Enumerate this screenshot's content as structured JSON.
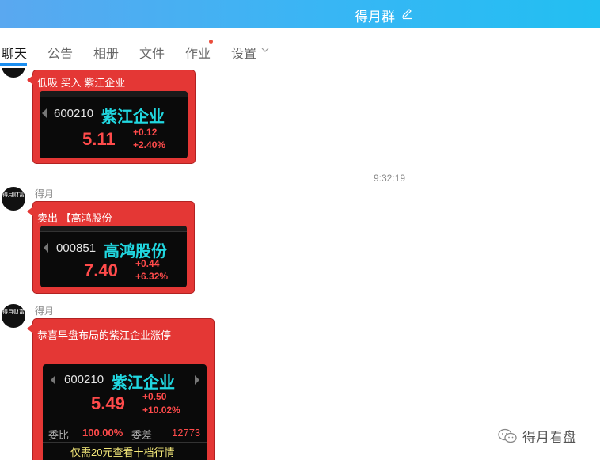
{
  "header": {
    "title": "得月群",
    "edit_icon": "edit-icon",
    "colors": {
      "start": "#5aa8f0",
      "end": "#22bff2"
    }
  },
  "tabs": [
    {
      "label": "聊天",
      "active": true
    },
    {
      "label": "公告"
    },
    {
      "label": "相册"
    },
    {
      "label": "文件"
    },
    {
      "label": "作业",
      "badge_dot": true
    },
    {
      "label": "设置",
      "dropdown": true
    }
  ],
  "timestamp": "9:32:19",
  "messages": [
    {
      "text": "低吸  买入  紫江企业",
      "quote": {
        "code": "600210",
        "name": "紫江企业",
        "price": "5.11",
        "change": "+0.12",
        "pct": "+2.40%"
      }
    },
    {
      "sender": "得月",
      "text": "卖出 【高鸿股份",
      "quote": {
        "code": "000851",
        "name": "高鸿股份",
        "price": "7.40",
        "change": "+0.44",
        "pct": "+6.32%"
      }
    },
    {
      "sender": "得月",
      "text": "恭喜早盘布局的紫江企业涨停",
      "quote": {
        "code": "600210",
        "name": "紫江企业",
        "price": "5.49",
        "change": "+0.50",
        "pct": "+10.02%",
        "weibi_label": "委比",
        "weibi_value": "100.00%",
        "weicha_label": "委差",
        "weicha_value": "12773",
        "promo": "仅需20元查看十档行情"
      }
    }
  ],
  "avatar_text": "得月财富",
  "watermark": "得月看盘",
  "colors": {
    "bubble": "#e43735",
    "quote_bg": "#0a0a0a",
    "stock_name": "#21d7e0",
    "up": "#ff4b4b",
    "accent": "#1b8ef0"
  }
}
